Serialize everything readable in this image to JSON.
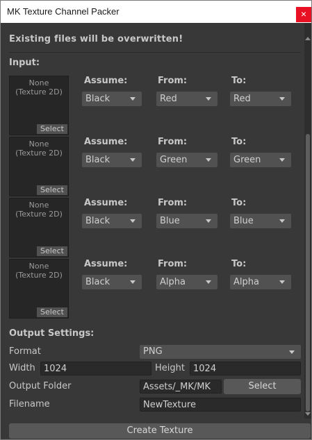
{
  "window": {
    "title": "MK Texture Channel Packer",
    "close_glyph": "×"
  },
  "warning": "Existing files will be overwritten!",
  "input": {
    "label": "Input:",
    "slot_none": "None",
    "slot_type": "(Texture 2D)",
    "slot_select": "Select",
    "assume_label": "Assume:",
    "from_label": "From:",
    "to_label": "To:",
    "channels": [
      {
        "assume": "Black",
        "from": "Red",
        "to": "Red"
      },
      {
        "assume": "Black",
        "from": "Green",
        "to": "Green"
      },
      {
        "assume": "Black",
        "from": "Blue",
        "to": "Blue"
      },
      {
        "assume": "Black",
        "from": "Alpha",
        "to": "Alpha"
      }
    ]
  },
  "output": {
    "label": "Output Settings:",
    "format_label": "Format",
    "format_value": "PNG",
    "width_label": "Width",
    "width_value": "1024",
    "height_label": "Height",
    "height_value": "1024",
    "folder_label": "Output Folder",
    "folder_value": "Assets/_MK/MK",
    "folder_select": "Select",
    "filename_label": "Filename",
    "filename_value": "NewTexture"
  },
  "create_button": "Create Texture",
  "colors": {
    "close": "#e81123",
    "background": "#383838",
    "field": "#2a2a2a",
    "button": "#585858"
  }
}
